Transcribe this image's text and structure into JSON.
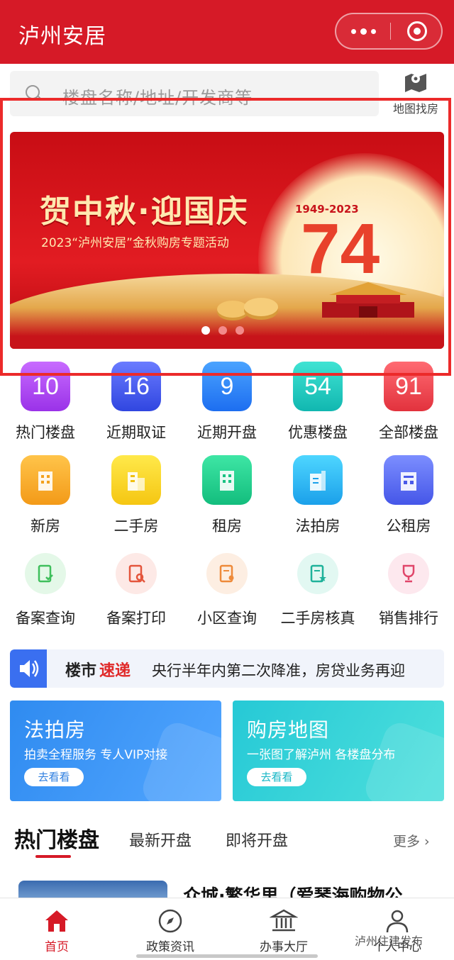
{
  "header": {
    "title": "泸州安居"
  },
  "search": {
    "placeholder": "楼盘名称/地址/开发商等",
    "map_label": "地图找房"
  },
  "banner": {
    "title": "贺中秋·迎国庆",
    "subtitle": "2023“泸州安居”金秋购房专题活动",
    "years": "1949-2023",
    "number": "74",
    "slides": 3,
    "active_slide": 1
  },
  "stats": [
    {
      "count": "10",
      "label": "热门楼盘"
    },
    {
      "count": "16",
      "label": "近期取证"
    },
    {
      "count": "9",
      "label": "近期开盘"
    },
    {
      "count": "54",
      "label": "优惠楼盘"
    },
    {
      "count": "91",
      "label": "全部楼盘"
    }
  ],
  "services": [
    {
      "label": "新房",
      "icon": "building-icon"
    },
    {
      "label": "二手房",
      "icon": "house-icon"
    },
    {
      "label": "租房",
      "icon": "apartment-icon"
    },
    {
      "label": "法拍房",
      "icon": "court-auction-icon"
    },
    {
      "label": "公租房",
      "icon": "public-housing-icon"
    }
  ],
  "tools": [
    {
      "label": "备案查询",
      "icon": "record-query-icon"
    },
    {
      "label": "备案打印",
      "icon": "record-print-icon"
    },
    {
      "label": "小区查询",
      "icon": "community-query-icon"
    },
    {
      "label": "二手房核真",
      "icon": "verify-icon"
    },
    {
      "label": "销售排行",
      "icon": "trophy-icon"
    }
  ],
  "news": {
    "tag_black": "楼市",
    "tag_red": "速递",
    "headline": "央行半年内第二次降准，房贷业务再迎"
  },
  "cards": [
    {
      "title": "法拍房",
      "subtitle": "拍卖全程服务  专人VIP对接",
      "button": "去看看"
    },
    {
      "title": "购房地图",
      "subtitle": "一张图了解泸州  各楼盘分布",
      "button": "去看看"
    }
  ],
  "tabs": {
    "main": "热门楼盘",
    "second": "最新开盘",
    "third": "即将开盘",
    "more": "更多 ›"
  },
  "listing": {
    "title": "众城·繁华里（爱琴海购物公"
  },
  "bottom_nav": [
    {
      "label": "首页",
      "icon": "home-icon"
    },
    {
      "label": "政策资讯",
      "icon": "compass-icon"
    },
    {
      "label": "办事大厅",
      "icon": "hall-icon"
    },
    {
      "label": "个人中心",
      "icon": "user-icon"
    }
  ],
  "watermark": "泸州住建发布",
  "colors": {
    "brand": "#d61a27",
    "highlight": "#ec2a2a",
    "news_blue": "#3a6ff0"
  }
}
